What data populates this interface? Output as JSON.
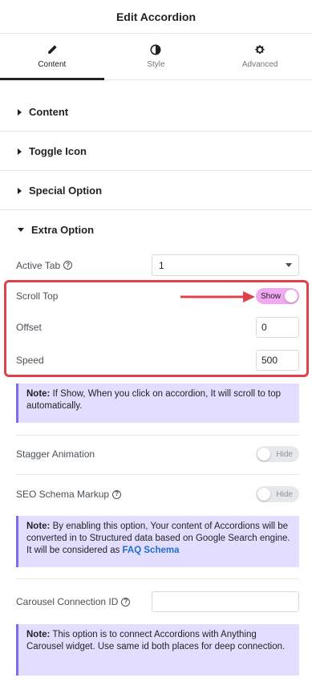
{
  "header": {
    "title": "Edit Accordion"
  },
  "tabs": [
    {
      "label": "Content",
      "icon": "pencil-icon",
      "active": true
    },
    {
      "label": "Style",
      "icon": "half-circle-icon",
      "active": false
    },
    {
      "label": "Advanced",
      "icon": "gear-icon",
      "active": false
    }
  ],
  "sections": [
    {
      "label": "Content",
      "expanded": false
    },
    {
      "label": "Toggle Icon",
      "expanded": false
    },
    {
      "label": "Special Option",
      "expanded": false
    },
    {
      "label": "Extra Option",
      "expanded": true
    }
  ],
  "extra_option": {
    "active_tab": {
      "label": "Active Tab",
      "value": "1"
    },
    "scroll_top": {
      "label": "Scroll Top",
      "toggle_text": "Show",
      "state": "on"
    },
    "offset": {
      "label": "Offset",
      "value": "0"
    },
    "speed": {
      "label": "Speed",
      "value": "500"
    },
    "note_scroll": {
      "prefix": "Note:",
      "text": " If Show, When you click on accordion, It will scroll to top automatically."
    },
    "stagger_animation": {
      "label": "Stagger Animation",
      "toggle_text": "Hide",
      "state": "off"
    },
    "seo_schema": {
      "label": "SEO Schema Markup",
      "toggle_text": "Hide",
      "state": "off"
    },
    "note_seo": {
      "prefix": "Note:",
      "text": " By enabling this option, Your content of Accordions will be converted in to Structured data based on Google Search engine. It will be considered as ",
      "link": "FAQ Schema"
    },
    "carousel_connection": {
      "label": "Carousel Connection ID",
      "value": ""
    },
    "note_carousel": {
      "prefix": "Note:",
      "text": " This option is to connect Accordions with Anything Carousel widget. Use same id both places for deep connection."
    }
  },
  "colors": {
    "highlight": "#e0424c",
    "toggle_on": "#f0a8f0",
    "note_bg": "#e3deff",
    "note_border": "#7a6cf0",
    "link": "#1f6fd0"
  }
}
